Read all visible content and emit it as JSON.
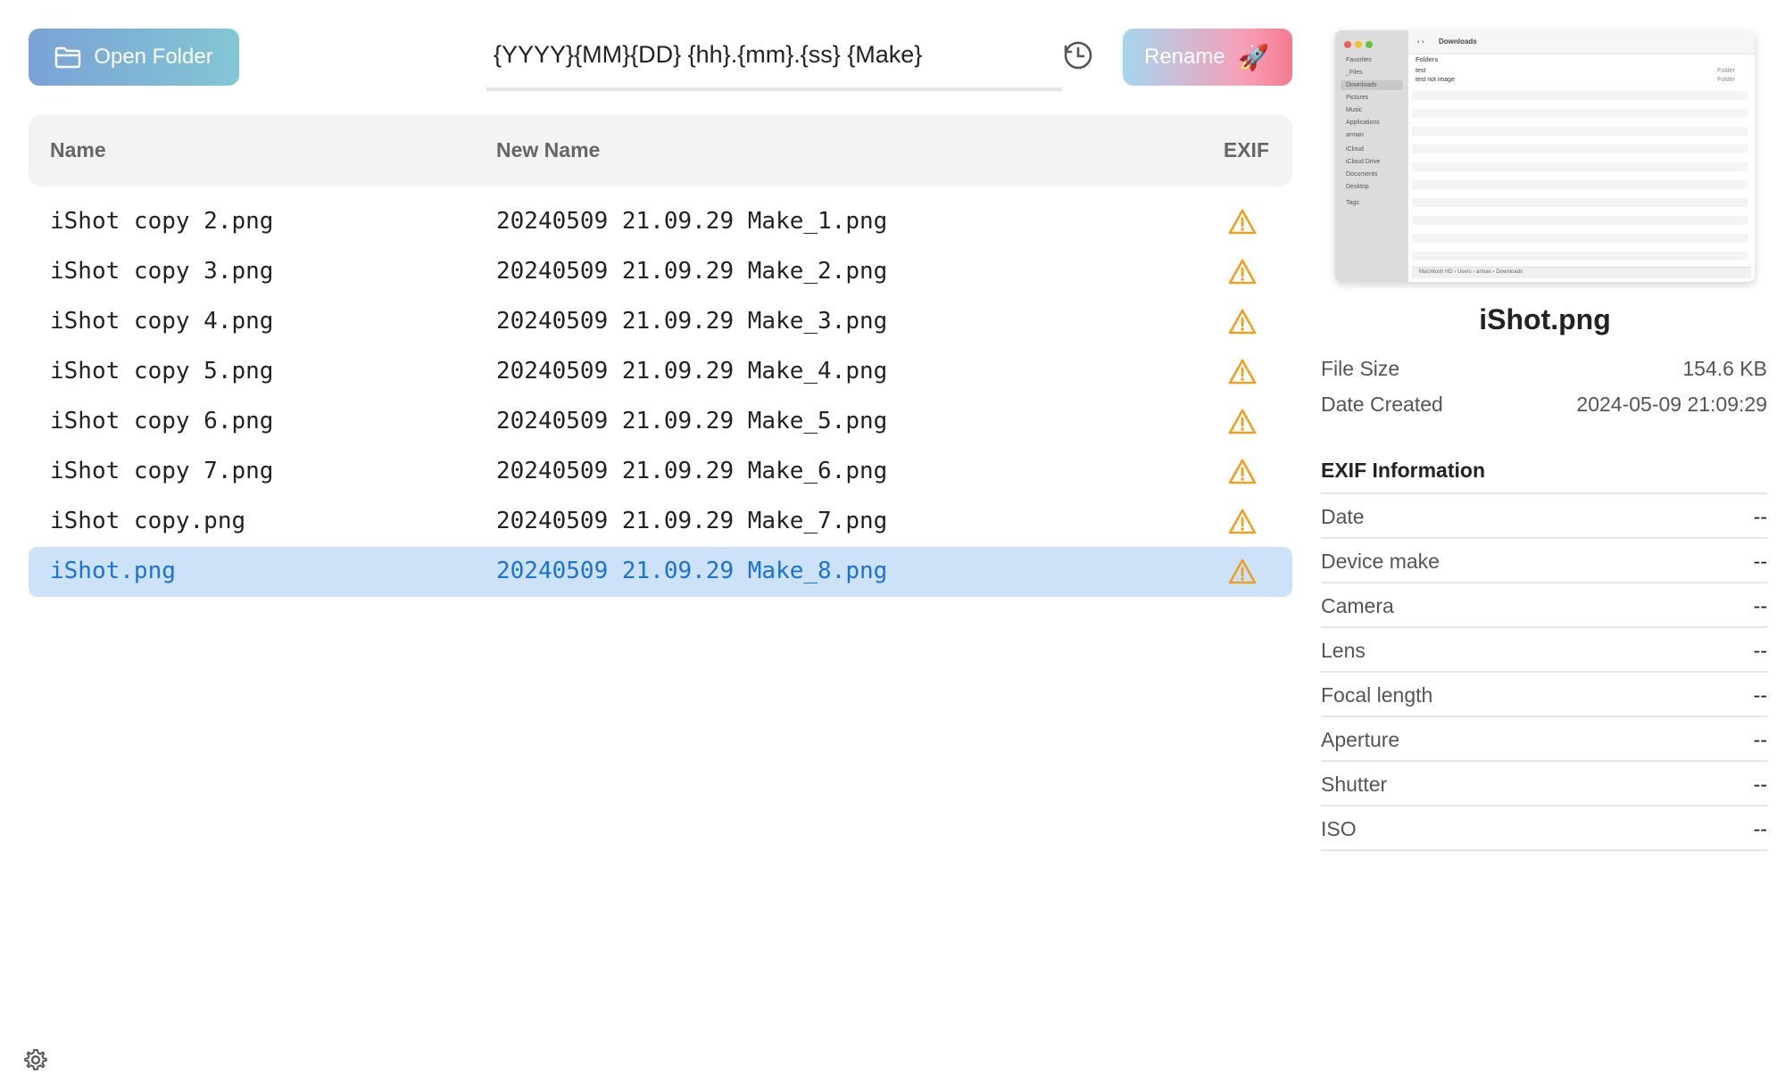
{
  "toolbar": {
    "open_folder_label": "Open Folder",
    "pattern_value": "{YYYY}{MM}{DD} {hh}.{mm}.{ss} {Make}",
    "rename_label": "Rename",
    "rename_icon": "rocket-icon",
    "history_icon": "clock-icon"
  },
  "table": {
    "headers": {
      "name": "Name",
      "new_name": "New Name",
      "exif": "EXIF"
    },
    "rows": [
      {
        "name": "iShot copy 2.png",
        "new_name": "20240509 21.09.29 Make_1.png",
        "exif_icon": "warning-icon"
      },
      {
        "name": "iShot copy 3.png",
        "new_name": "20240509 21.09.29 Make_2.png",
        "exif_icon": "warning-icon"
      },
      {
        "name": "iShot copy 4.png",
        "new_name": "20240509 21.09.29 Make_3.png",
        "exif_icon": "warning-icon"
      },
      {
        "name": "iShot copy 5.png",
        "new_name": "20240509 21.09.29 Make_4.png",
        "exif_icon": "warning-icon"
      },
      {
        "name": "iShot copy 6.png",
        "new_name": "20240509 21.09.29 Make_5.png",
        "exif_icon": "warning-icon"
      },
      {
        "name": "iShot copy 7.png",
        "new_name": "20240509 21.09.29 Make_6.png",
        "exif_icon": "warning-icon"
      },
      {
        "name": "iShot copy.png",
        "new_name": "20240509 21.09.29 Make_7.png",
        "exif_icon": "warning-icon"
      },
      {
        "name": "iShot.png",
        "new_name": "20240509 21.09.29 Make_8.png",
        "exif_icon": "warning-icon",
        "selected": true
      }
    ]
  },
  "preview": {
    "window_title": "Downloads",
    "sidebar": [
      "Favorites",
      "_Files",
      "Downloads",
      "Pictures",
      "Music",
      "Applications",
      "arman",
      "iCloud",
      "iCloud Drive",
      "Documents",
      "Desktop",
      "Tags"
    ],
    "column_header": "Folders",
    "items": [
      "test",
      "test not image"
    ],
    "kind": "Folder",
    "path_bar": "Macintosh HD › Users › arman › Downloads"
  },
  "details": {
    "file_name": "iShot.png",
    "file_size_label": "File Size",
    "file_size_value": "154.6 KB",
    "date_created_label": "Date Created",
    "date_created_value": "2024-05-09 21:09:29"
  },
  "exif": {
    "title": "EXIF Information",
    "fields": [
      {
        "label": "Date",
        "value": "--"
      },
      {
        "label": "Device make",
        "value": "--"
      },
      {
        "label": "Camera",
        "value": "--"
      },
      {
        "label": "Lens",
        "value": "--"
      },
      {
        "label": "Focal length",
        "value": "--"
      },
      {
        "label": "Aperture",
        "value": "--"
      },
      {
        "label": "Shutter",
        "value": "--"
      },
      {
        "label": "ISO",
        "value": "--"
      }
    ]
  },
  "colors": {
    "warning": "#f0a020",
    "selected_bg": "#cde1f8",
    "selected_text": "#1a72d6"
  },
  "footer": {
    "settings_icon": "gear-icon"
  }
}
